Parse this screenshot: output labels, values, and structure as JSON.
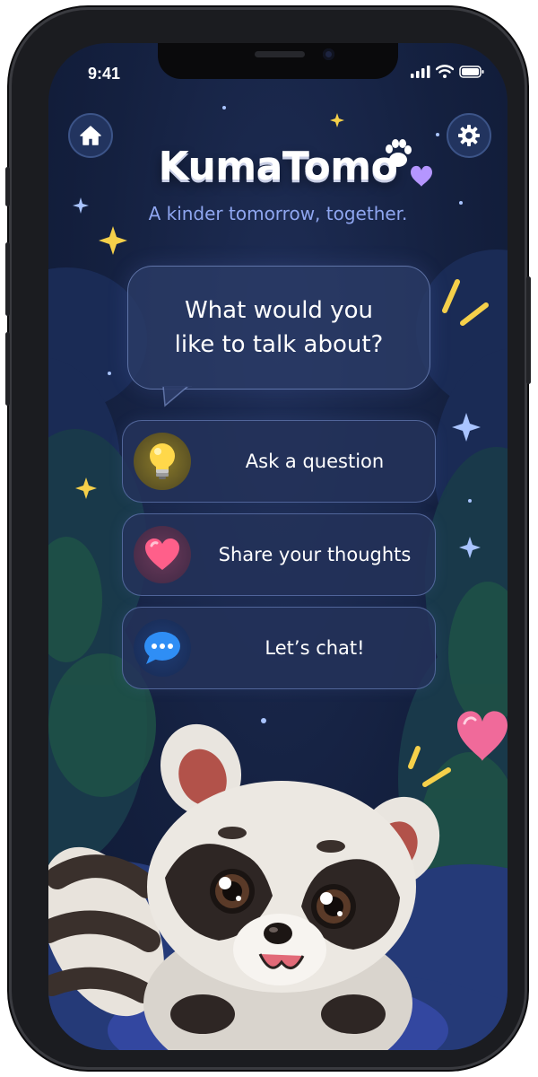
{
  "status_bar": {
    "time": "9:41"
  },
  "header": {
    "home_icon": "home-icon",
    "settings_icon": "gear-icon",
    "logo_text": "KumaTomo",
    "tagline": "A kinder tomorrow, together."
  },
  "prompt": {
    "text": "What would you\nlike to talk about?"
  },
  "options": [
    {
      "label": "Ask a question",
      "icon": "lightbulb-icon"
    },
    {
      "label": "Share your thoughts",
      "icon": "heart-icon"
    },
    {
      "label": "Let’s chat!",
      "icon": "chat-bubble-icon"
    }
  ],
  "mascot": {
    "icon": "raccoon-mascot"
  },
  "colors": {
    "background": "#14203f",
    "accent": "#8fa6f0",
    "sparkle": "#f5d04a",
    "heart": "#f06a9a"
  }
}
